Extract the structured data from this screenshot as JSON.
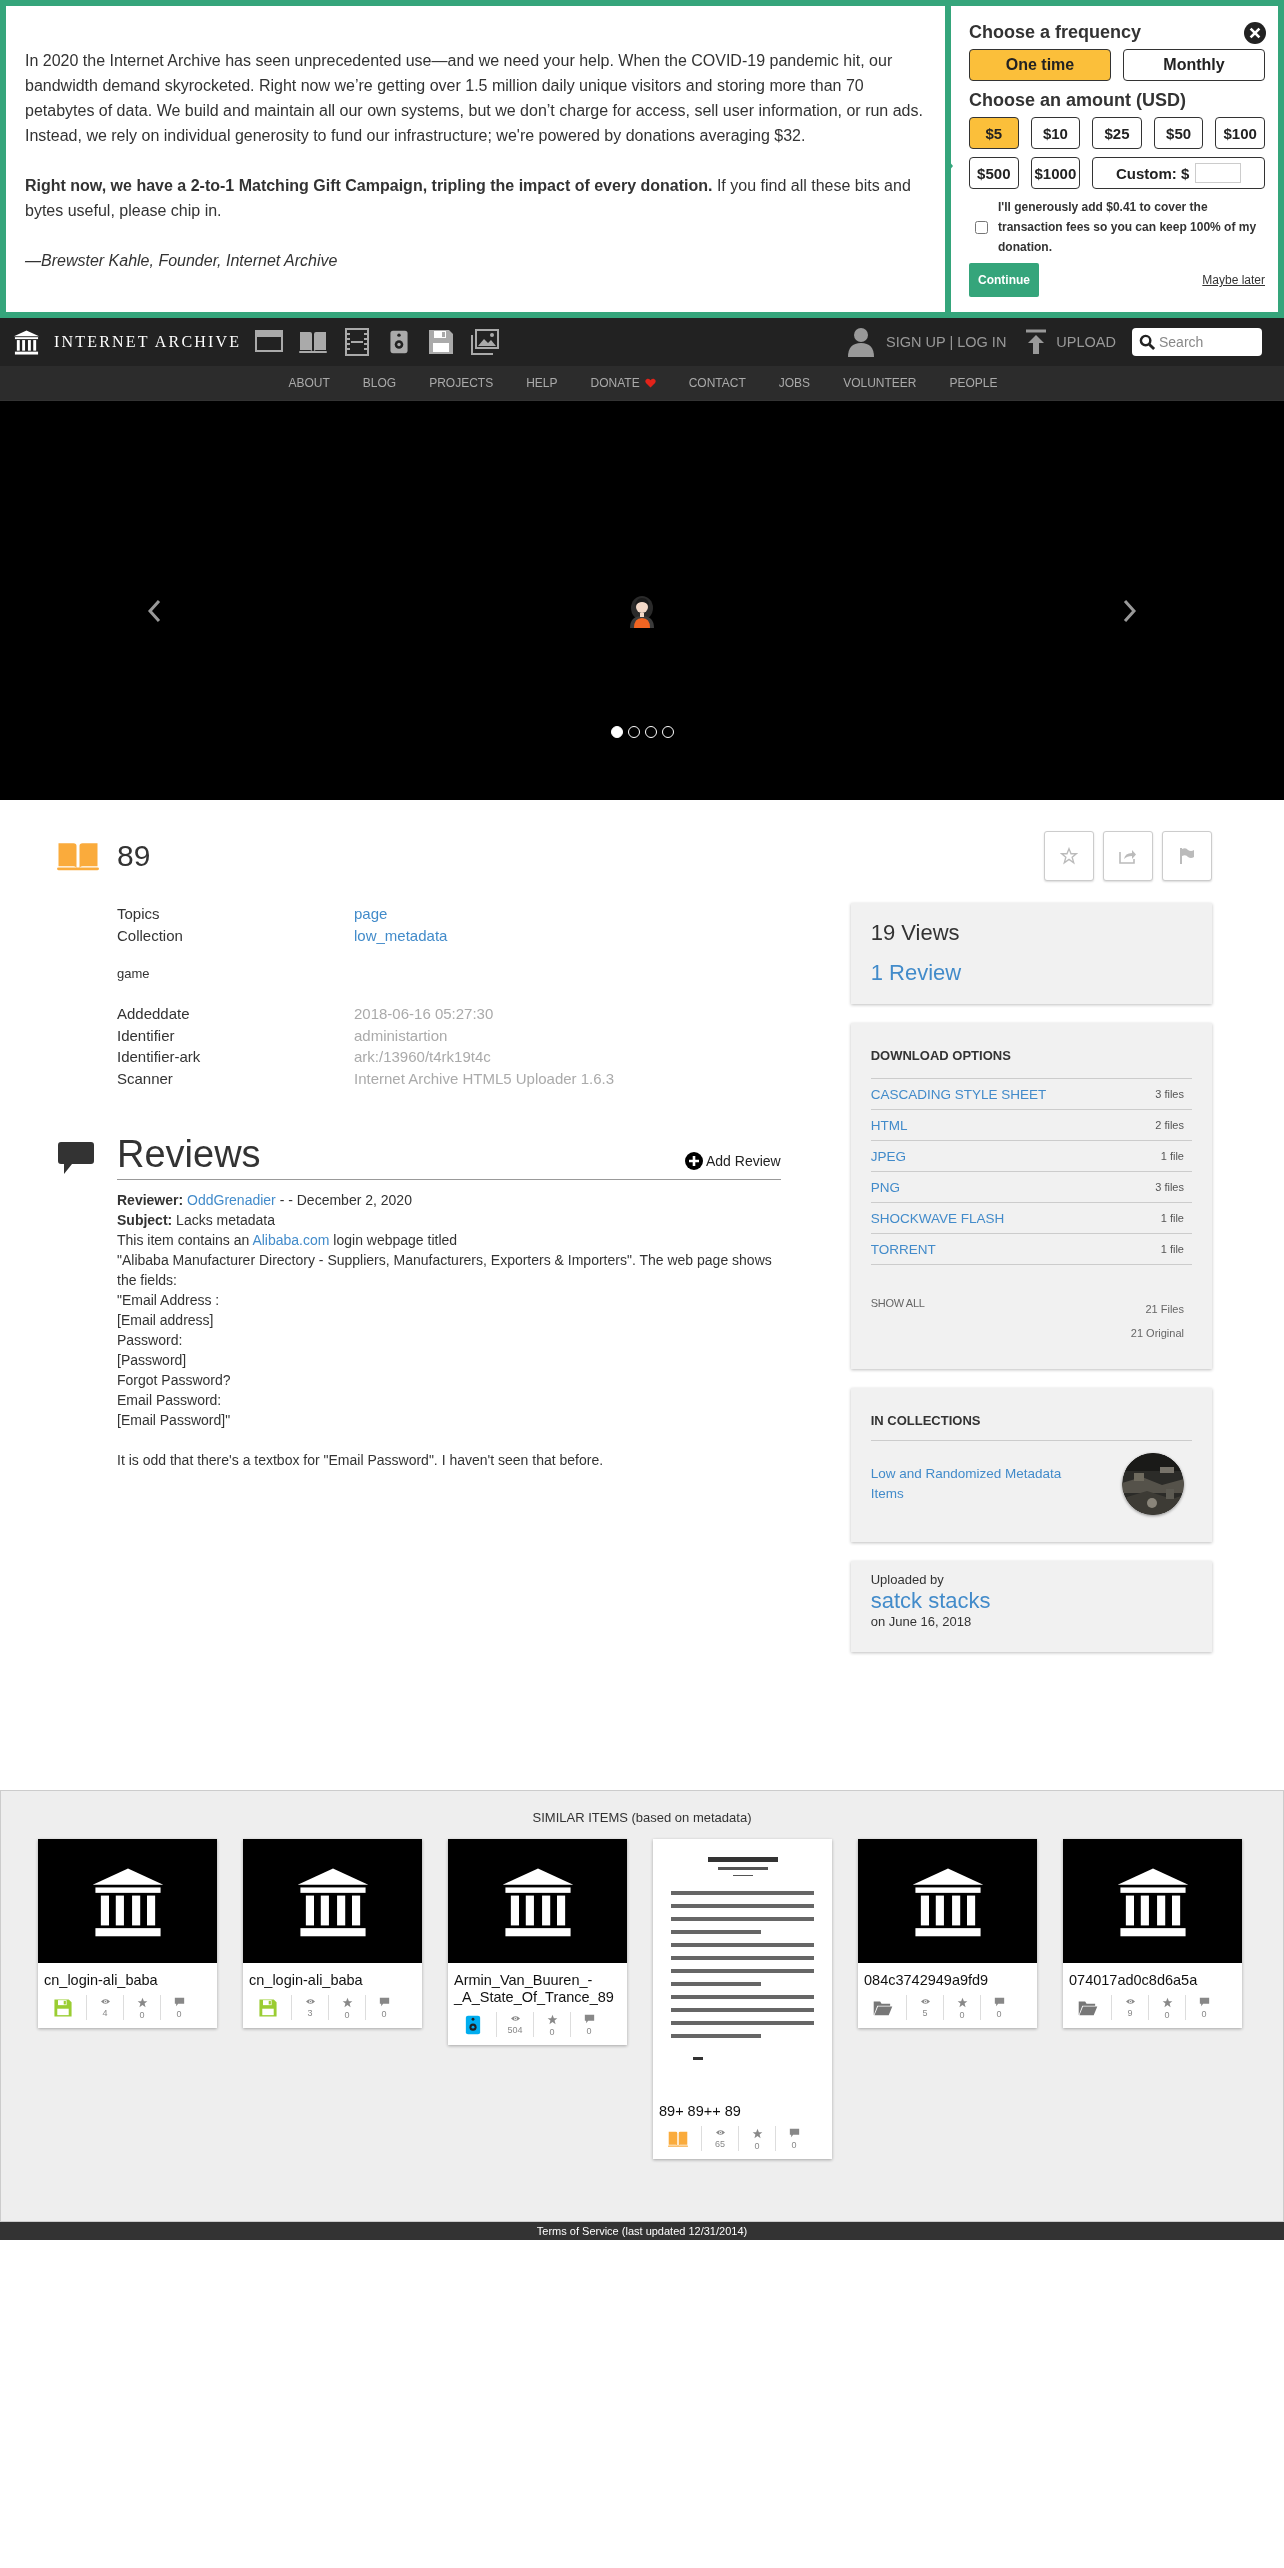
{
  "donation_banner": {
    "appeal": "In 2020 the Internet Archive has seen unprecedented use—and we need your help. When the COVID-19 pandemic hit, our bandwidth demand skyrocketed. Right now we’re getting over 1.5 million daily unique visitors and storing more than 70 petabytes of data. We build and maintain all our own systems, but we don’t charge for access, sell user information, or run ads. Instead, we rely on individual generosity to fund our infrastructure; we're powered by donations averaging $32.",
    "matching": "**Right now, we have a 2-to-1 Matching Gift Campaign, tripling the impact of every donation.** If you find all these bits and bytes useful, please chip in.",
    "signature": "—Brewster Kahle, Founder, Internet Archive",
    "frequency_title": "Choose a frequency",
    "frequencies": [
      {
        "label": "One time",
        "selected": true
      },
      {
        "label": "Monthly",
        "selected": false
      }
    ],
    "amount_title": "Choose an amount (USD)",
    "amounts": [
      {
        "label": "$5",
        "selected": true
      },
      {
        "label": "$10",
        "selected": false
      },
      {
        "label": "$25",
        "selected": false
      },
      {
        "label": "$50",
        "selected": false
      },
      {
        "label": "$100",
        "selected": false
      },
      {
        "label": "$500",
        "selected": false
      },
      {
        "label": "$1000",
        "selected": false
      }
    ],
    "custom_label": "Custom: $",
    "fee_checked": false,
    "fee_text": "I'll generously add $0.41 to cover the transaction fees so you can keep 100% of my donation.",
    "continue_label": "Continue",
    "maybe_later": "Maybe later"
  },
  "top_nav": {
    "logo_text": "INTERNET ARCHIVE",
    "auth": "SIGN UP | LOG IN",
    "upload": "UPLOAD",
    "search_placeholder": "Search"
  },
  "menu": [
    {
      "label": "ABOUT",
      "kind": "link"
    },
    {
      "label": "BLOG",
      "kind": "link"
    },
    {
      "label": "PROJECTS",
      "kind": "link"
    },
    {
      "label": "HELP",
      "kind": "link"
    },
    {
      "label": "DONATE",
      "kind": "donate"
    },
    {
      "label": "CONTACT",
      "kind": "link"
    },
    {
      "label": "JOBS",
      "kind": "link"
    },
    {
      "label": "VOLUNTEER",
      "kind": "link"
    },
    {
      "label": "PEOPLE",
      "kind": "link"
    }
  ],
  "carousel": {
    "slides": [
      {
        "selected": true
      },
      {
        "selected": false
      },
      {
        "selected": false
      },
      {
        "selected": false
      }
    ]
  },
  "item": {
    "title": "89",
    "metadata": [
      {
        "label": "Topics",
        "value": "page",
        "kind": "link"
      },
      {
        "label": "Collection",
        "value": "low_metadata",
        "kind": "link"
      }
    ],
    "description": "game",
    "details": [
      {
        "label": "Addeddate",
        "value": "2018-06-16 05:27:30",
        "kind": "muted"
      },
      {
        "label": "Identifier",
        "value": "administartion",
        "kind": "muted"
      },
      {
        "label": "Identifier-ark",
        "value": "ark:/13960/t4rk19t4c",
        "kind": "muted"
      },
      {
        "label": "Scanner",
        "value": "Internet Archive HTML5 Uploader 1.6.3",
        "kind": "muted"
      }
    ]
  },
  "reviews": {
    "title": "Reviews",
    "add_label": "Add Review",
    "items": [
      {
        "reviewer_label": "Reviewer:",
        "reviewer": "OddGrenadier",
        "date": "- - December 2, 2020",
        "subject_label": "Subject:",
        "subject": "Lacks metadata",
        "body_before": "This item contains an",
        "body_link": "Alibaba.com",
        "body_after": "login webpage titled",
        "body_lines": [
          "\"Alibaba Manufacturer Directory - Suppliers, Manufacturers, Exporters & Importers\". The web page shows the fields:",
          "\"Email Address :",
          "[Email address]",
          "Password:",
          "[Password]",
          "Forgot Password?",
          "Email Password:",
          "[Email Password]\""
        ],
        "closing": "It is odd that there's a textbox for \"Email Password\". I haven't seen that before."
      }
    ]
  },
  "sidebar": {
    "views": "19 Views",
    "reviews_link": "1 Review",
    "downloads": {
      "title": "DOWNLOAD OPTIONS",
      "formats": [
        {
          "name": "CASCADING STYLE SHEET",
          "count": "3 files"
        },
        {
          "name": "HTML",
          "count": "2 files"
        },
        {
          "name": "JPEG",
          "count": "1 file"
        },
        {
          "name": "PNG",
          "count": "3 files"
        },
        {
          "name": "SHOCKWAVE FLASH",
          "count": "1 file"
        },
        {
          "name": "TORRENT",
          "count": "1 file"
        }
      ],
      "show_all": "SHOW ALL",
      "files_total": "21 Files",
      "original_total": "21 Original"
    },
    "collections": {
      "title": "IN COLLECTIONS",
      "items": [
        {
          "name": "Low and Randomized Metadata Items"
        }
      ]
    },
    "uploader": {
      "label": "Uploaded by",
      "name": "satck stacks",
      "date": "on June 16, 2018"
    }
  },
  "similar": {
    "title": "SIMILAR ITEMS (based on metadata)",
    "items": [
      {
        "title": "cn_login-ali_baba",
        "kind": "software",
        "thumbnail": {
          "kind": "logo"
        },
        "views": "4",
        "favorites": "0",
        "reviews": "0"
      },
      {
        "title": "cn_login-ali_baba",
        "kind": "software",
        "thumbnail": {
          "kind": "logo"
        },
        "views": "3",
        "favorites": "0",
        "reviews": "0"
      },
      {
        "title": "Armin_Van_Buuren_-_A_State_Of_Trance_89",
        "kind": "audio",
        "thumbnail": {
          "kind": "logo"
        },
        "views": "504",
        "favorites": "0",
        "reviews": "0"
      },
      {
        "title": "89+ 89++ 89",
        "kind": "texts",
        "thumbnail": {
          "kind": "document"
        },
        "views": "65",
        "favorites": "0",
        "reviews": "0"
      },
      {
        "title": "084c3742949a9fd9",
        "kind": "collection",
        "thumbnail": {
          "kind": "logo"
        },
        "views": "5",
        "favorites": "0",
        "reviews": "0"
      },
      {
        "title": "074017ad0c8d6a5a",
        "kind": "collection",
        "thumbnail": {
          "kind": "logo"
        },
        "views": "9",
        "favorites": "0",
        "reviews": "0"
      }
    ]
  },
  "footer": "Terms of Service (last updated 12/31/2014)"
}
